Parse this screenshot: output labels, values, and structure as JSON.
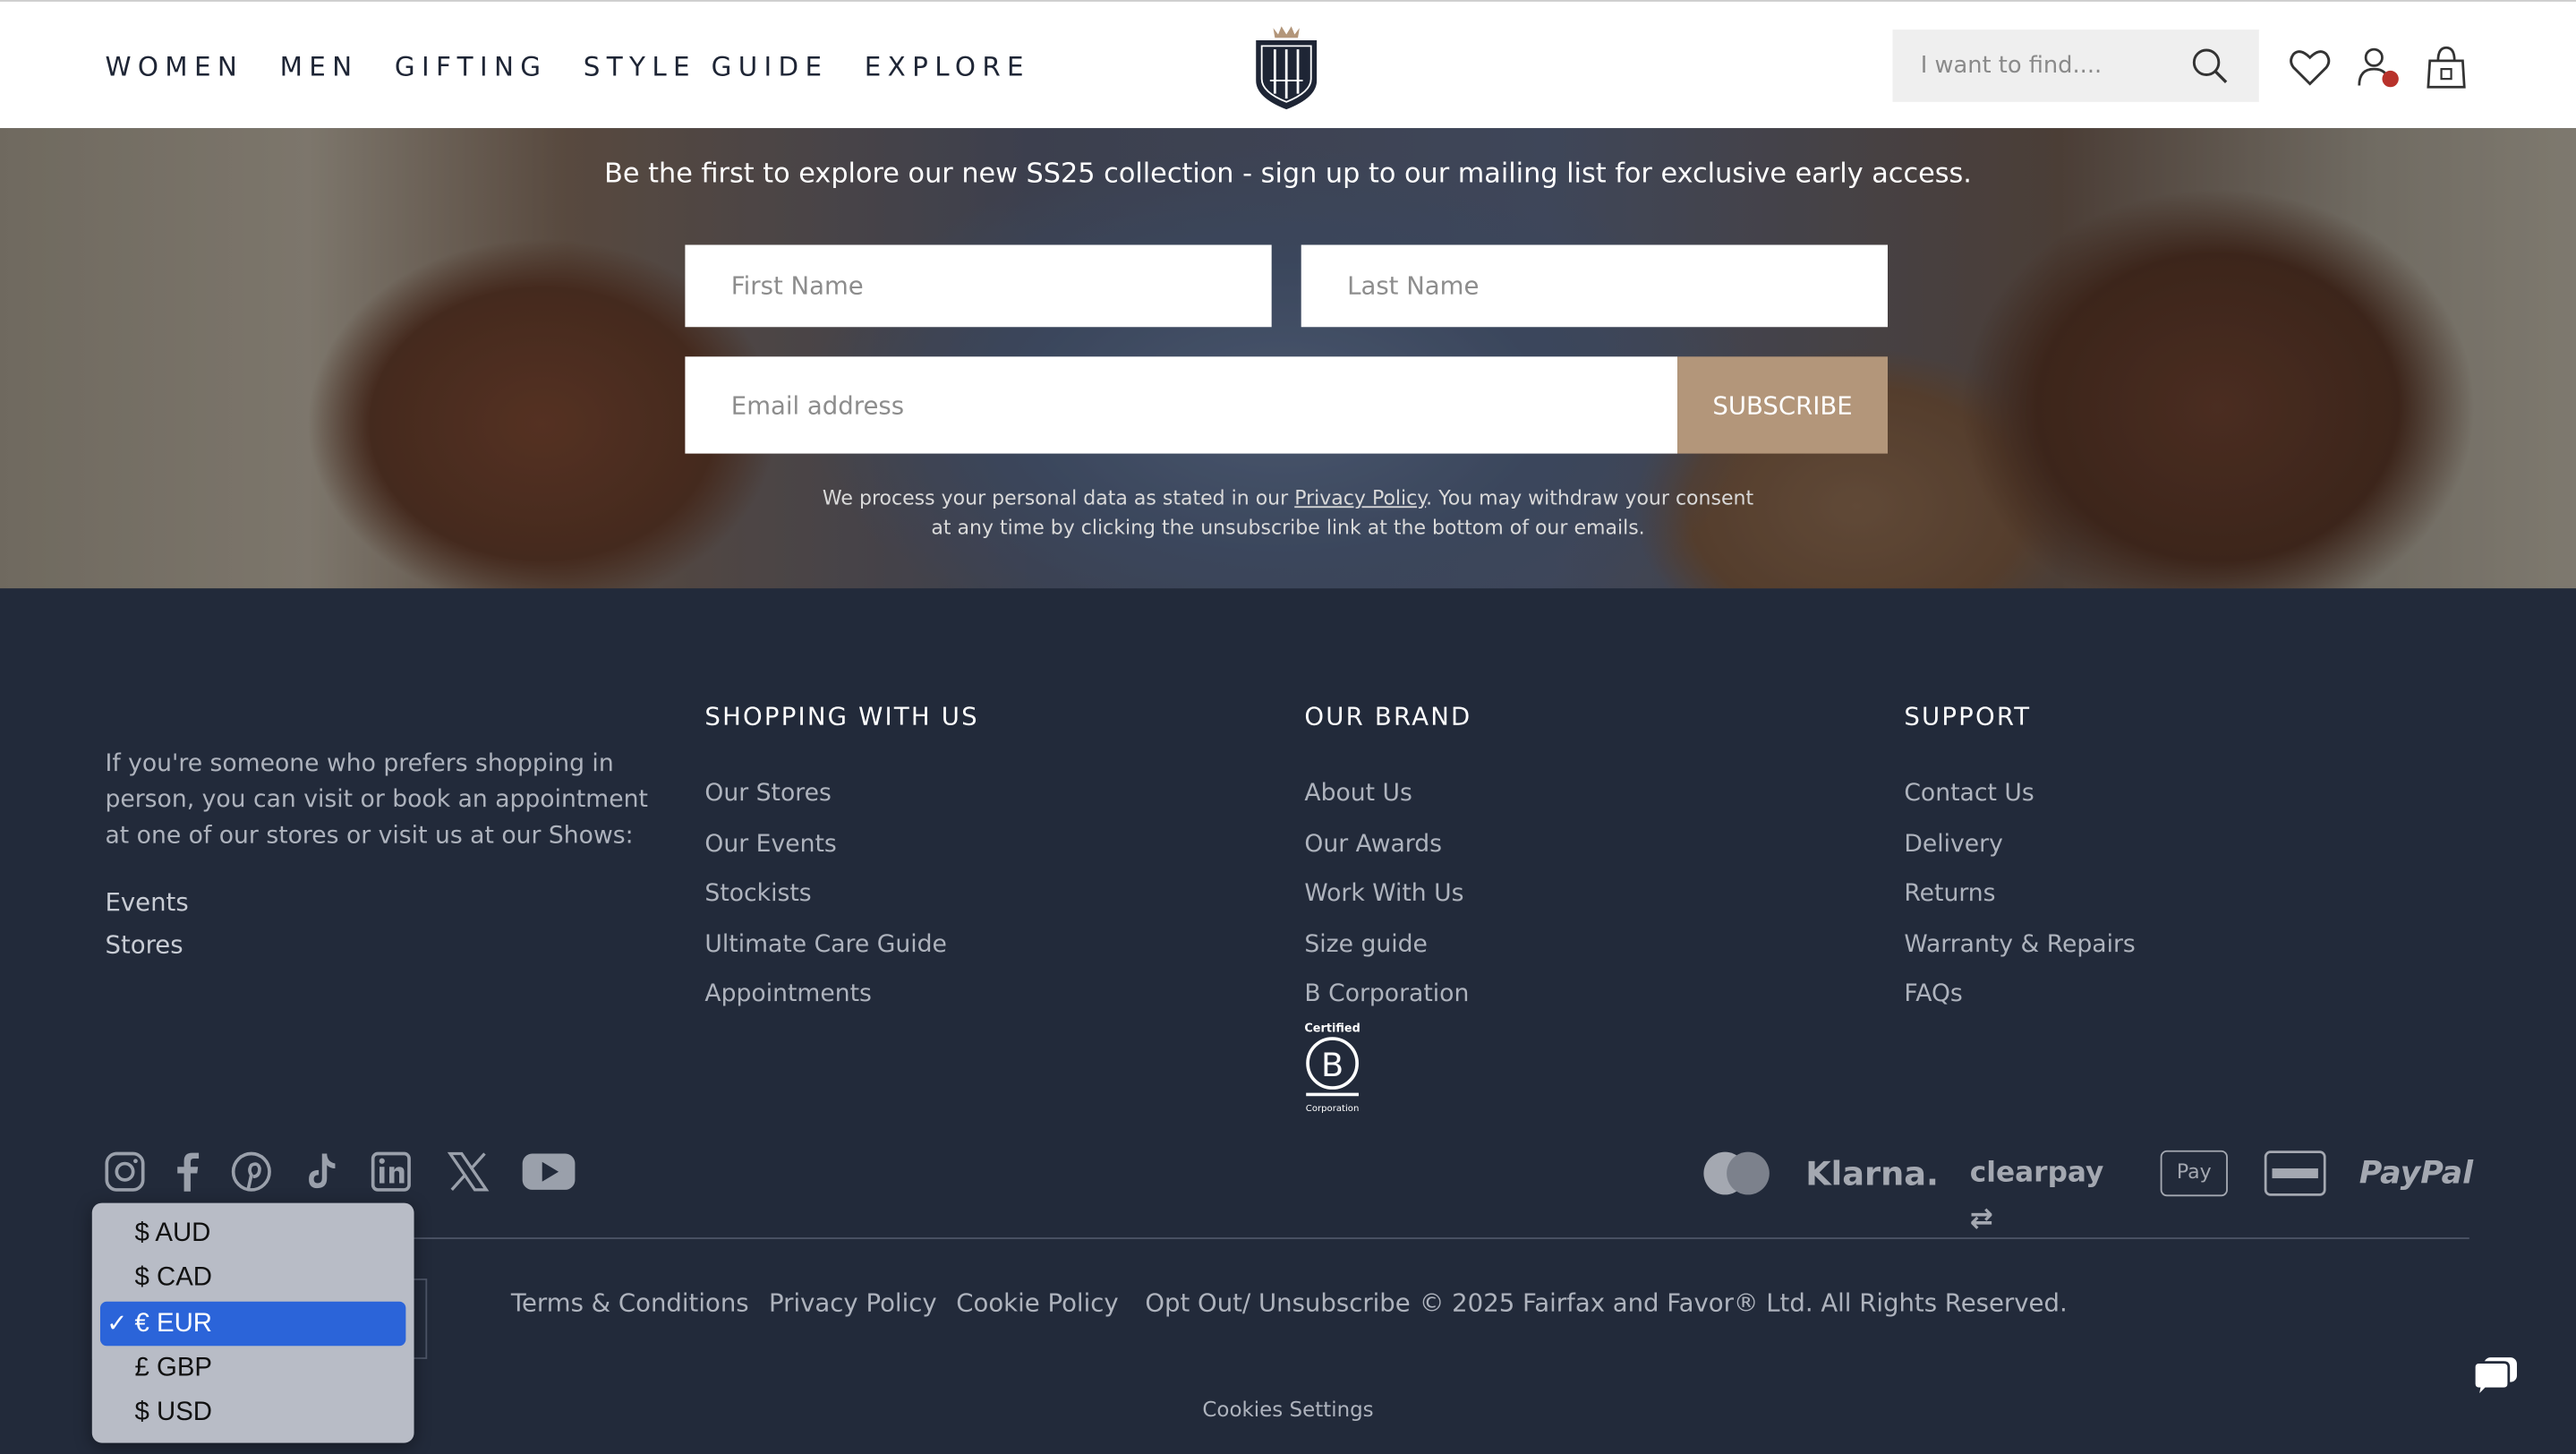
{
  "header": {
    "nav": [
      "WOMEN",
      "MEN",
      "GIFTING",
      "STYLE GUIDE",
      "EXPLORE"
    ],
    "search_placeholder": "I want to find....",
    "icons": [
      "search-icon",
      "heart-icon",
      "account-icon",
      "bag-icon"
    ],
    "logo_icon": "crest-logo"
  },
  "hero": {
    "headline": "Be the first to explore our new SS25 collection - sign up to our mailing list for exclusive early access.",
    "first_name_placeholder": "First Name",
    "last_name_placeholder": "Last Name",
    "email_placeholder": "Email address",
    "subscribe_label": "SUBSCRIBE",
    "consent_before": "We process your personal data as stated in our ",
    "consent_link": "Privacy Policy",
    "consent_after": ". You may withdraw your consent",
    "consent_line2": "at any time by clicking the unsubscribe link at the bottom of our emails."
  },
  "footer": {
    "intro": "If you're someone who prefers shopping in person, you can visit or book an appointment at one of our stores or visit us at our Shows:",
    "left_links": [
      "Events",
      "Stores"
    ],
    "columns": [
      {
        "heading": "SHOPPING WITH US",
        "links": [
          "Our Stores",
          "Our Events",
          "Stockists",
          "Ultimate Care Guide",
          "Appointments"
        ]
      },
      {
        "heading": "OUR BRAND",
        "links": [
          "About Us",
          "Our Awards",
          "Work With Us",
          "Size guide",
          "B Corporation"
        ]
      },
      {
        "heading": "SUPPORT",
        "links": [
          "Contact Us",
          "Delivery",
          "Returns",
          "Warranty & Repairs",
          "FAQs"
        ]
      }
    ],
    "bcorp": {
      "top": "Certified",
      "bottom": "Corporation"
    },
    "social_icons": [
      "instagram-icon",
      "facebook-icon",
      "pinterest-icon",
      "tiktok-icon",
      "linkedin-icon",
      "x-icon",
      "youtube-icon"
    ],
    "payment_icons": [
      "mastercard-icon",
      "klarna-logo",
      "clearpay-logo",
      "apple-pay-icon",
      "amex-icon",
      "paypal-logo"
    ],
    "payment_text": {
      "klarna": "Klarna.",
      "clearpay": "clearpay",
      "applepay": "Pay",
      "paypal": "PayPal"
    },
    "legal_links": [
      "Terms & Conditions",
      "Privacy Policy",
      "Cookie Policy",
      "Opt Out/ Unsubscribe"
    ],
    "copyright": "© 2025 Fairfax and Favor® Ltd. All Rights Reserved.",
    "cookies_settings": "Cookies Settings",
    "chat_icon": "chat-icon"
  },
  "currency": {
    "options": [
      "$ AUD",
      "$ CAD",
      "€ EUR",
      "£ GBP",
      "$ USD"
    ],
    "selected": "€ EUR",
    "check": "✓"
  },
  "colors": {
    "navy": "#222a3a",
    "gold": "#b3967a",
    "selected_blue": "#2b64d9"
  }
}
